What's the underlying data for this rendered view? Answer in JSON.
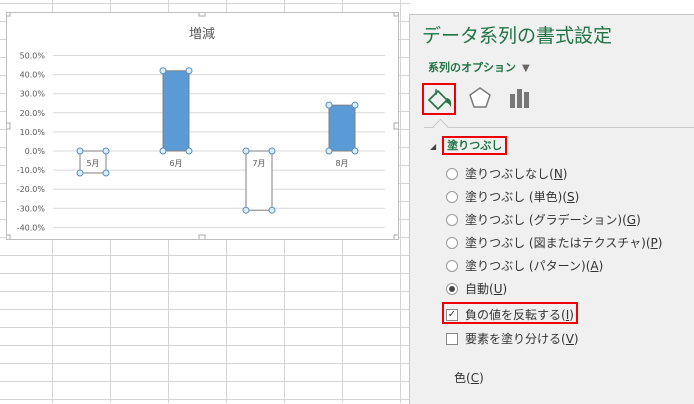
{
  "chart_data": {
    "type": "bar",
    "title": "増減",
    "categories": [
      "5月",
      "6月",
      "7月",
      "8月"
    ],
    "values": [
      -11.5,
      42,
      -31,
      24
    ],
    "ylim": [
      -40,
      50
    ],
    "yticks": [
      "50.0%",
      "40.0%",
      "30.0%",
      "20.0%",
      "10.0%",
      "0.0%",
      "-10.0%",
      "-20.0%",
      "-30.0%",
      "-40.0%"
    ],
    "ytick_values": [
      50,
      40,
      30,
      20,
      10,
      0,
      -10,
      -20,
      -30,
      -40
    ],
    "colors": {
      "positive": "#5b9bd5",
      "negative": "#ffffff"
    },
    "grid": true,
    "invert_if_negative": true
  },
  "panel": {
    "title": "データ系列の書式設定",
    "options_label": "系列のオプション",
    "section": "塗りつぶし",
    "fill_options": [
      {
        "label": "塗りつぶしなし",
        "key": "N",
        "selected": false
      },
      {
        "label": "塗りつぶし (単色)",
        "key": "S",
        "selected": false
      },
      {
        "label": "塗りつぶし (グラデーション)",
        "key": "G",
        "selected": false
      },
      {
        "label": "塗りつぶし (図またはテクスチャ)",
        "key": "P",
        "selected": false
      },
      {
        "label": "塗りつぶし (パターン)",
        "key": "A",
        "selected": false
      },
      {
        "label": "自動",
        "key": "U",
        "selected": true
      }
    ],
    "checks": [
      {
        "label": "負の値を反転する",
        "key": "I",
        "checked": true
      },
      {
        "label": "要素を塗り分ける",
        "key": "V",
        "checked": false
      }
    ],
    "color_label": "色",
    "color_key": "C"
  }
}
